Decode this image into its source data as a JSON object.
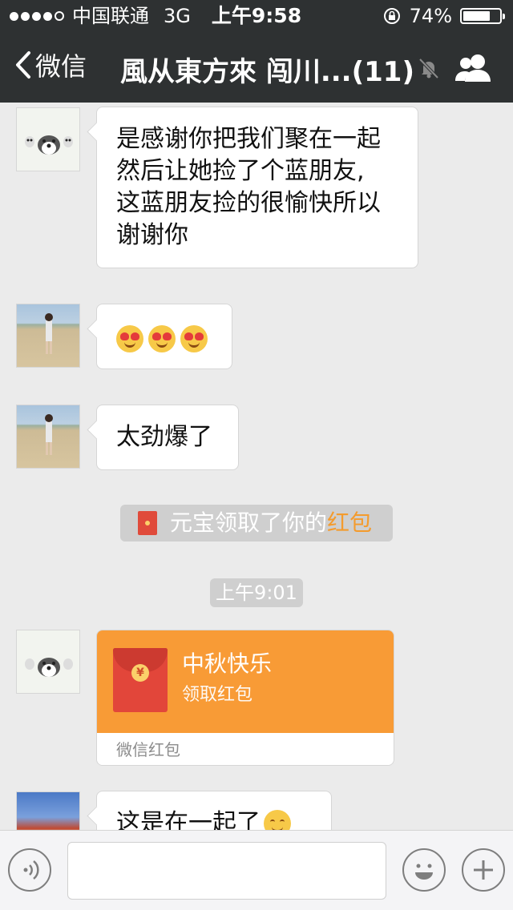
{
  "status_bar": {
    "carrier": "中国联通",
    "network": "3G",
    "time": "上午9:58",
    "battery": "74%",
    "battery_level": 0.74
  },
  "nav": {
    "back_label": "微信",
    "title": "風从東方來 闯川...(11)"
  },
  "messages": [
    {
      "type": "text",
      "lines": [
        "是感谢你把我们聚在一起",
        "然后让她捡了个蓝朋友,",
        "这蓝朋友捡的很愉快所以",
        "谢谢你"
      ]
    },
    {
      "type": "emoji",
      "icons": [
        "heart-eyes-emoji",
        "heart-eyes-emoji",
        "heart-eyes-emoji"
      ]
    },
    {
      "type": "text",
      "text": "太劲爆了"
    },
    {
      "type": "system",
      "text_prefix": "元宝领取了你的",
      "text_highlight": "红包"
    },
    {
      "type": "timestamp",
      "text": "上午9:01"
    },
    {
      "type": "hongbao",
      "title": "中秋快乐",
      "subtitle": "领取红包",
      "footer": "微信红包"
    },
    {
      "type": "text",
      "text": "这是在一起了"
    }
  ],
  "colors": {
    "header_bg": "#2e3132",
    "chat_bg": "#ebebeb",
    "hongbao_orange": "#f89b36",
    "highlight_orange": "#f49b2d"
  }
}
